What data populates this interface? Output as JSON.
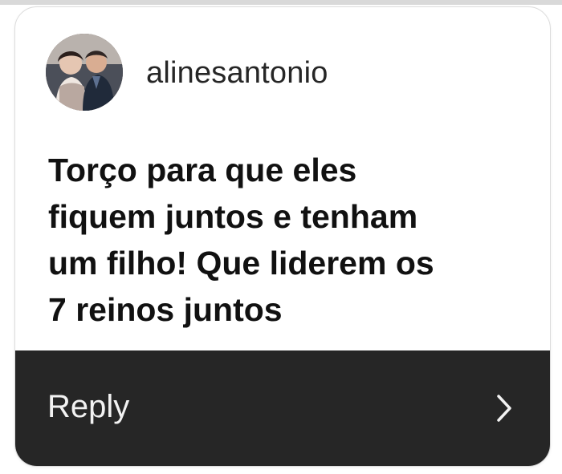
{
  "comment_card": {
    "username": "alinesantonio",
    "comment_text": "Torço para que eles\nfiquem juntos e tenham\num filho! Que liderem os\n7 reinos juntos",
    "reply_label": "Reply"
  },
  "icons": {
    "avatar": "profile-photo",
    "chevron": "chevron-right-icon"
  },
  "colors": {
    "reply_bar": "#262626",
    "text_primary": "#111111",
    "username": "#262626"
  }
}
